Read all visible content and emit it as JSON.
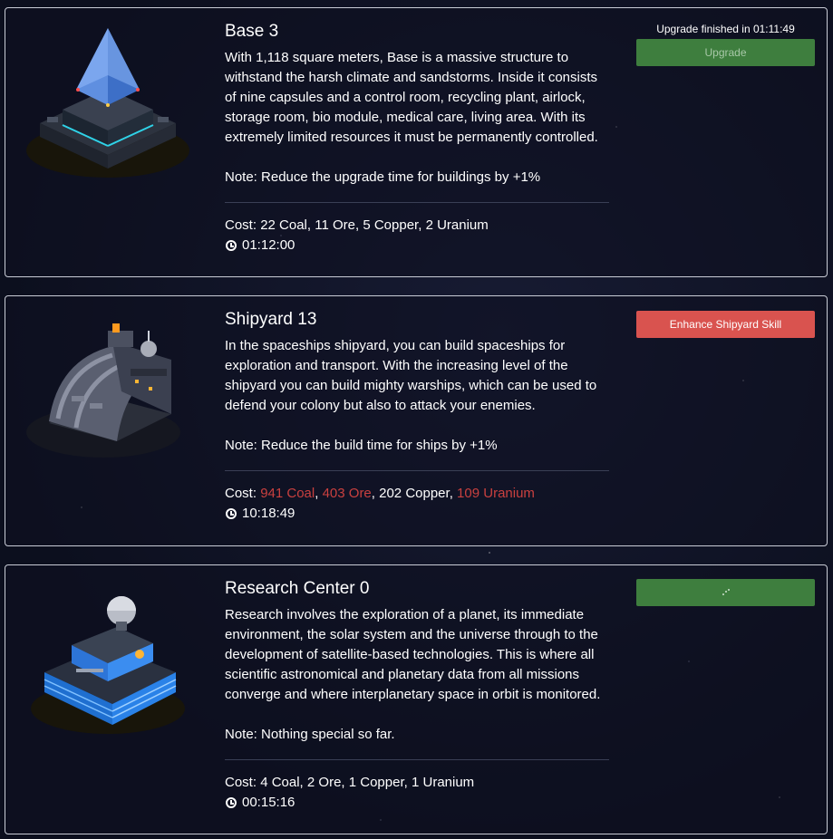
{
  "buildings": [
    {
      "title": "Base 3",
      "description": "With 1,118 square meters, Base is a massive structure to withstand the harsh climate and sandstorms. Inside it consists of nine capsules and a control room, recycling plant, airlock, storage room, bio module, medical care, living area. With its extremely limited resources it must be permanently controlled.",
      "note": "Note: Reduce the upgrade time for buildings by +1%",
      "cost_label": "Cost:",
      "cost": [
        "22 Coal",
        "11 Ore",
        "5 Copper",
        "2 Uranium"
      ],
      "time": "01:12:00",
      "status": "Upgrade finished in 01:11:49",
      "button_label": "Upgrade"
    },
    {
      "title": "Shipyard 13",
      "description": "In the spaceships shipyard, you can build spaceships for exploration and transport. With the increasing level of the shipyard you can build mighty warships, which can be used to defend your colony but also to attack your enemies.",
      "note": "Note: Reduce the build time for ships by +1%",
      "cost_label": "Cost:",
      "cost": [
        "941 Coal",
        "403 Ore",
        "202 Copper",
        "109 Uranium"
      ],
      "time": "10:18:49",
      "button_label": "Enhance Shipyard Skill"
    },
    {
      "title": "Research Center 0",
      "description": "Research involves the exploration of a planet, its immediate environment, the solar system and the universe through to the development of satellite-based technologies. This is where all scientific astronomical and planetary data from all missions converge and where interplanetary space in orbit is monitored.",
      "note": "Note: Nothing special so far.",
      "cost_label": "Cost:",
      "cost": [
        "4 Coal",
        "2 Ore",
        "1 Copper",
        "1 Uranium"
      ],
      "time": "00:15:16",
      "button_icon": "spinner-icon"
    }
  ],
  "colors": {
    "insufficient": "#c9403f",
    "button_green": "#3e7e3e",
    "button_red": "#d9534f",
    "card_border": "#c9ccd6"
  }
}
